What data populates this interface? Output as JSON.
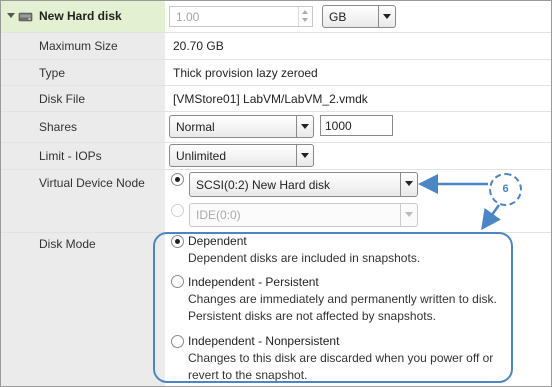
{
  "header": {
    "title": "New Hard disk",
    "size_value": "1.00",
    "size_unit": "GB",
    "expand_icon": "caret-down-icon",
    "disk_icon": "hard-disk-icon"
  },
  "fields": {
    "max_size": {
      "label": "Maximum Size",
      "value": "20.70 GB"
    },
    "type": {
      "label": "Type",
      "value": "Thick provision lazy zeroed"
    },
    "disk_file": {
      "label": "Disk File",
      "value": "[VMStore01] LabVM/LabVM_2.vmdk"
    },
    "shares": {
      "label": "Shares",
      "selected": "Normal",
      "value": "1000"
    },
    "limit_iops": {
      "label": "Limit - IOPs",
      "selected": "Unlimited"
    },
    "virtual_device_node": {
      "label": "Virtual Device Node",
      "primary": "SCSI(0:2) New Hard disk",
      "secondary": "IDE(0:0)"
    },
    "disk_mode": {
      "label": "Disk Mode",
      "options": [
        {
          "title": "Dependent",
          "desc": [
            "Dependent disks are included in snapshots."
          ],
          "selected": true
        },
        {
          "title": "Independent - Persistent",
          "desc": [
            "Changes are immediately and permanently written to disk.",
            "Persistent disks are not affected by snapshots."
          ],
          "selected": false
        },
        {
          "title": "Independent - Nonpersistent",
          "desc": [
            "Changes to this disk are discarded when you power off or",
            "revert to the snapshot."
          ],
          "selected": false
        }
      ]
    }
  },
  "annotation": {
    "callout_number": "6"
  },
  "colors": {
    "header_bg": "#e3f1d2",
    "label_bg": "#ebebeb",
    "accent_blue": "#4a86c6"
  }
}
